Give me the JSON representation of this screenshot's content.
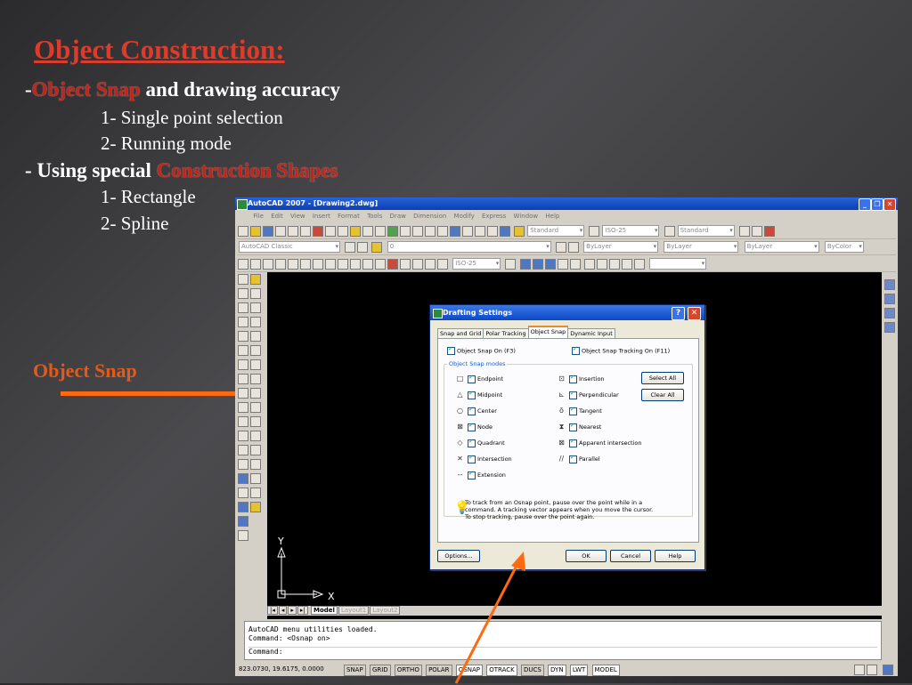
{
  "slide": {
    "title": "Object Construction:",
    "bullet1_dash": "-",
    "bullet1_hl": "Object Snap",
    "bullet1_rest": " and drawing accuracy",
    "sub1": "1- Single point selection",
    "sub2": "2- Running mode",
    "bullet2_dash": "- Using special ",
    "bullet2_hl": "Construction Shapes",
    "sub3": "1- Rectangle",
    "sub4": "2- Spline",
    "side_label": "Object Snap"
  },
  "acad": {
    "title": "AutoCAD 2007 - [Drawing2.dwg]",
    "menu": [
      "File",
      "Edit",
      "View",
      "Insert",
      "Format",
      "Tools",
      "Draw",
      "Dimension",
      "Modify",
      "Express",
      "Window",
      "Help"
    ],
    "combos": {
      "text_style": "Standard",
      "dim_style": "ISO-25",
      "table_style": "Standard",
      "workspace": "AutoCAD Classic",
      "layer": "0",
      "color": "ByLayer",
      "linetype": "ByLayer",
      "lineweight": "ByLayer",
      "plotstyle": "ByColor",
      "dim_style2": "ISO-25"
    },
    "ucs_y": "Y",
    "ucs_x": "X",
    "layout_tabs": [
      "Model",
      "Layout1",
      "Layout2"
    ],
    "command_lines": [
      "AutoCAD menu utilities loaded.",
      "Command:  <Osnap on>",
      "",
      "Command:"
    ],
    "coords": "823.0730, 19.6175, 0.0000",
    "status_toggles": [
      {
        "label": "SNAP",
        "on": false
      },
      {
        "label": "GRID",
        "on": false
      },
      {
        "label": "ORTHO",
        "on": false
      },
      {
        "label": "POLAR",
        "on": false
      },
      {
        "label": "OSNAP",
        "on": true
      },
      {
        "label": "OTRACK",
        "on": true
      },
      {
        "label": "DUCS",
        "on": false
      },
      {
        "label": "DYN",
        "on": true
      },
      {
        "label": "LWT",
        "on": true
      },
      {
        "label": "MODEL",
        "on": true
      }
    ]
  },
  "dialog": {
    "title": "Drafting Settings",
    "tabs": [
      "Snap and Grid",
      "Polar Tracking",
      "Object Snap",
      "Dynamic Input"
    ],
    "active_tab": "Object Snap",
    "osnap_on": "Object Snap On (F3)",
    "osnap_tracking": "Object Snap Tracking On (F11)",
    "group_label": "Object Snap modes",
    "left_modes": [
      {
        "sym": "□",
        "label": "Endpoint"
      },
      {
        "sym": "△",
        "label": "Midpoint"
      },
      {
        "sym": "○",
        "label": "Center"
      },
      {
        "sym": "⊠",
        "label": "Node"
      },
      {
        "sym": "◇",
        "label": "Quadrant"
      },
      {
        "sym": "✕",
        "label": "Intersection"
      },
      {
        "sym": "--",
        "label": "Extension"
      }
    ],
    "right_modes": [
      {
        "sym": "⊡",
        "label": "Insertion"
      },
      {
        "sym": "⊾",
        "label": "Perpendicular"
      },
      {
        "sym": "ō",
        "label": "Tangent"
      },
      {
        "sym": "⧗",
        "label": "Nearest"
      },
      {
        "sym": "⊠",
        "label": "Apparent intersection"
      },
      {
        "sym": "//",
        "label": "Parallel"
      }
    ],
    "select_all": "Select All",
    "clear_all": "Clear All",
    "hint": "To track from an Osnap point, pause over the point while in a command.  A tracking vector appears when you move the cursor. To stop tracking, pause over the point again.",
    "options": "Options...",
    "ok": "OK",
    "cancel": "Cancel",
    "help": "Help"
  }
}
